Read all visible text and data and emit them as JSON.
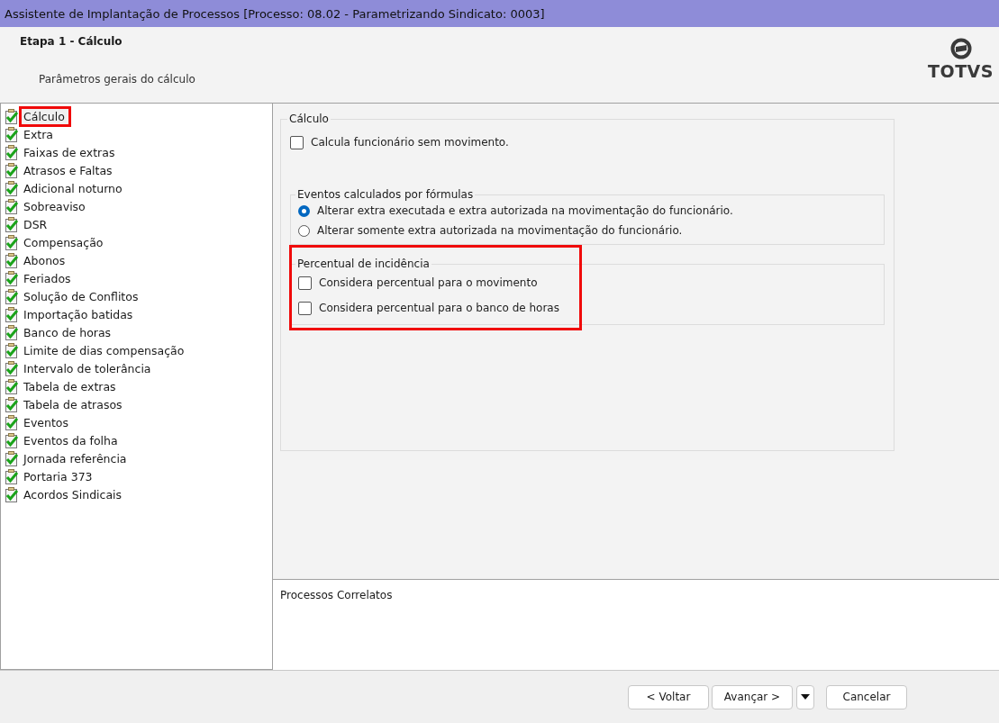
{
  "window": {
    "title": "Assistente de Implantação de Processos [Processo: 08.02 - Parametrizando Sindicato: 0003]"
  },
  "header": {
    "step": "Etapa 1 - Cálculo",
    "description": "Parâmetros gerais do cálculo",
    "logo": "TOTVS"
  },
  "steps": [
    {
      "label": "Cálculo",
      "selected": true
    },
    {
      "label": "Extra",
      "selected": false
    },
    {
      "label": "Faixas de extras",
      "selected": false
    },
    {
      "label": "Atrasos e Faltas",
      "selected": false
    },
    {
      "label": "Adicional noturno",
      "selected": false
    },
    {
      "label": "Sobreaviso",
      "selected": false
    },
    {
      "label": "DSR",
      "selected": false
    },
    {
      "label": "Compensação",
      "selected": false
    },
    {
      "label": "Abonos",
      "selected": false
    },
    {
      "label": "Feriados",
      "selected": false
    },
    {
      "label": "Solução de Conflitos",
      "selected": false
    },
    {
      "label": "Importação batidas",
      "selected": false
    },
    {
      "label": "Banco de horas",
      "selected": false
    },
    {
      "label": "Limite de dias compensação",
      "selected": false
    },
    {
      "label": "Intervalo de tolerância",
      "selected": false
    },
    {
      "label": "Tabela de extras",
      "selected": false
    },
    {
      "label": "Tabela de atrasos",
      "selected": false
    },
    {
      "label": "Eventos",
      "selected": false
    },
    {
      "label": "Eventos da folha",
      "selected": false
    },
    {
      "label": "Jornada referência",
      "selected": false
    },
    {
      "label": "Portaria 373",
      "selected": false
    },
    {
      "label": "Acordos Sindicais",
      "selected": false
    }
  ],
  "form": {
    "title": "Cálculo",
    "options": [
      {
        "kind": "checkbox",
        "label": "Calcula funcionário sem movimento.",
        "checked": false
      }
    ],
    "groups": [
      {
        "title": "Eventos calculados por fórmulas",
        "highlighted": false,
        "options": [
          {
            "kind": "radio",
            "label": "Alterar extra executada e extra autorizada na movimentação do funcionário.",
            "selected": true
          },
          {
            "kind": "radio",
            "label": "Alterar somente extra autorizada na movimentação do funcionário.",
            "selected": false
          }
        ]
      },
      {
        "title": "Percentual de incidência",
        "highlighted": true,
        "options": [
          {
            "kind": "checkbox",
            "label": "Considera percentual para o movimento",
            "checked": false
          },
          {
            "kind": "checkbox",
            "label": "Considera percentual para o banco de horas",
            "checked": false
          }
        ]
      }
    ]
  },
  "related": {
    "title": "Processos Correlatos"
  },
  "buttons": [
    {
      "kind": "text",
      "label": "< Voltar"
    },
    {
      "kind": "text",
      "label": "Avançar >"
    },
    {
      "kind": "dropdown"
    },
    {
      "kind": "text",
      "label": "Cancelar"
    }
  ]
}
